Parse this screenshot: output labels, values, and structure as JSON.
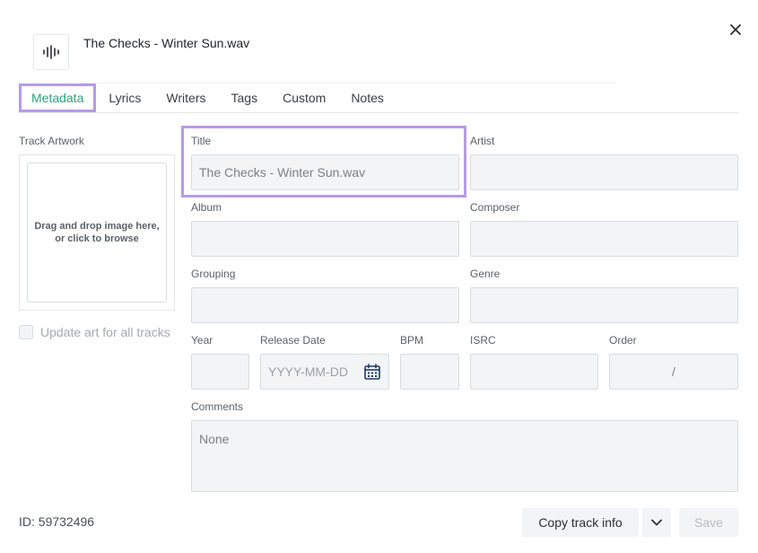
{
  "header": {
    "file_icon": "audio-waveform-icon",
    "file_title": "The Checks - Winter Sun.wav",
    "close_icon": "close-icon"
  },
  "tabs": [
    {
      "label": "Metadata",
      "active": true
    },
    {
      "label": "Lyrics",
      "active": false
    },
    {
      "label": "Writers",
      "active": false
    },
    {
      "label": "Tags",
      "active": false
    },
    {
      "label": "Custom",
      "active": false
    },
    {
      "label": "Notes",
      "active": false
    }
  ],
  "artwork": {
    "label": "Track Artwork",
    "dropzone_text": "Drag and drop image here, or click to browse",
    "update_all_label": "Update art for all tracks",
    "update_all_checked": false
  },
  "fields": {
    "title": {
      "label": "Title",
      "value": "The Checks - Winter Sun.wav"
    },
    "artist": {
      "label": "Artist",
      "value": ""
    },
    "album": {
      "label": "Album",
      "value": ""
    },
    "composer": {
      "label": "Composer",
      "value": ""
    },
    "grouping": {
      "label": "Grouping",
      "value": ""
    },
    "genre": {
      "label": "Genre",
      "value": ""
    },
    "year": {
      "label": "Year",
      "value": ""
    },
    "release_date": {
      "label": "Release Date",
      "placeholder": "YYYY-MM-DD",
      "icon": "calendar-icon"
    },
    "bpm": {
      "label": "BPM",
      "value": ""
    },
    "isrc": {
      "label": "ISRC",
      "value": ""
    },
    "order": {
      "label": "Order",
      "value": "/"
    },
    "comments": {
      "label": "Comments",
      "value": "None"
    }
  },
  "footer": {
    "id_text": "ID: 59732496",
    "copy_label": "Copy track info",
    "dropdown_icon": "chevron-down-icon",
    "save_label": "Save"
  },
  "colors": {
    "accent_green": "#2fa37a",
    "highlight_purple": "#b69be8",
    "field_bg": "#f2f4f5"
  }
}
